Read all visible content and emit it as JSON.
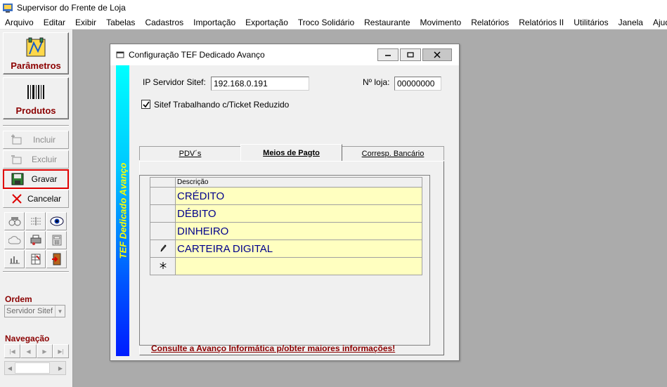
{
  "app": {
    "title": "Supervisor do Frente de Loja"
  },
  "menu": [
    "Arquivo",
    "Editar",
    "Exibir",
    "Tabelas",
    "Cadastros",
    "Importação",
    "Exportação",
    "Troco Solidário",
    "Restaurante",
    "Movimento",
    "Relatórios",
    "Relatórios II",
    "Utilitários",
    "Janela",
    "Ajuda"
  ],
  "sidebar": {
    "parametros": "Parâmetros",
    "produtos": "Produtos",
    "incluir": "Incluir",
    "excluir": "Excluir",
    "gravar": "Gravar",
    "cancelar": "Cancelar",
    "ordem_label": "Ordem",
    "ordem_value": "Servidor Sitef",
    "navegacao_label": "Navegação"
  },
  "dialog": {
    "title": "Configuração TEF Dedicado Avanço",
    "stripe_text": "TEF Dedicado Avanço",
    "ip_label": "IP Servidor Sitef:",
    "ip_value": "192.168.0.191",
    "loja_label": "Nº loja:",
    "loja_value": "00000000",
    "checkbox_label": "Sitef Trabalhando c/Ticket Reduzido",
    "checkbox_checked": true,
    "tabs": [
      "PDV´s",
      "Meios de Pagto",
      "Corresp. Bancário"
    ],
    "active_tab": "Meios de Pagto",
    "grid": {
      "header": "Descrição",
      "rows": [
        "CRÉDITO",
        "DÉBITO",
        "DINHEIRO",
        "CARTEIRA DIGITAL",
        ""
      ]
    },
    "footer": "Consulte a Avanço Informática p/obter maiores informações!"
  },
  "colors": {
    "accent_red": "#8b0000",
    "grid_cell": "#ffffc0",
    "highlight": "#e00000"
  }
}
